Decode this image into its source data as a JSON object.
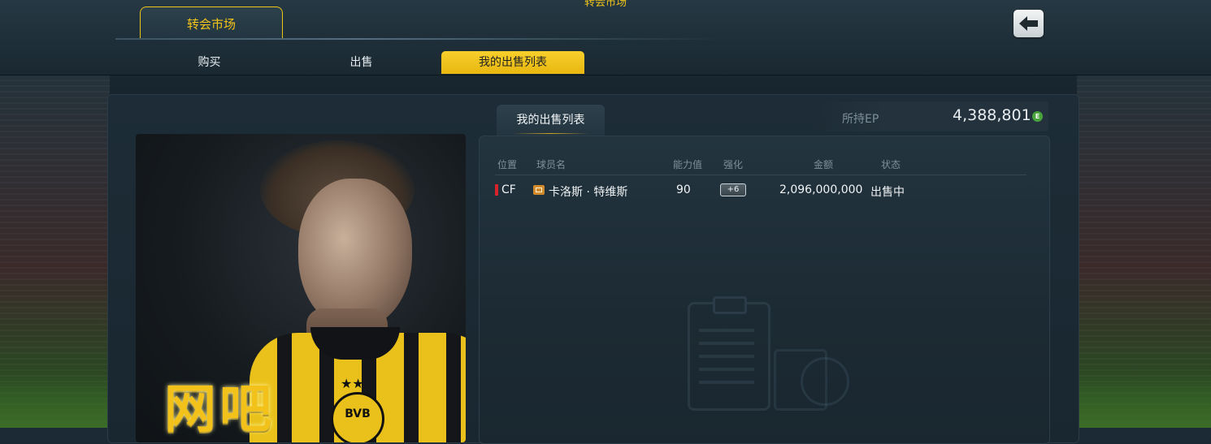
{
  "header": {
    "title": "转会市场",
    "main_tab": "转会市场",
    "sub_tabs": [
      "购买",
      "出售",
      "我的出售列表"
    ]
  },
  "panel": {
    "list_tab": "我的出售列表",
    "ep_label": "所持EP",
    "ep_value": "4,388,801",
    "ep_coin": "E"
  },
  "table": {
    "columns": [
      "位置",
      "球员名",
      "能力值",
      "强化",
      "金额",
      "状态"
    ],
    "rows": [
      {
        "position": "CF",
        "player": "卡洛斯 · 特维斯",
        "rating": "90",
        "upgrade": "+6",
        "price": "2,096,000,000",
        "status": "出售中"
      }
    ]
  },
  "card": {
    "watermark": "网吧",
    "crest_text": "BVB",
    "stars": "★★"
  },
  "colors": {
    "accent": "#f0c419",
    "position_marker": "#d6232a",
    "ep_coin": "#48a33a"
  }
}
